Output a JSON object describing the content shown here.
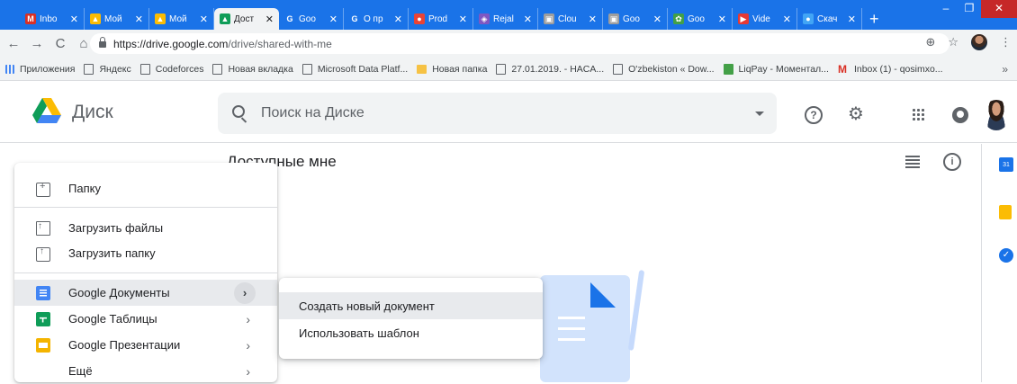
{
  "browser": {
    "tabs": [
      {
        "label": "Inbo",
        "color": "#d93025",
        "glyph": "M"
      },
      {
        "label": "Мой",
        "color": "#fbbc04",
        "glyph": "▲"
      },
      {
        "label": "Мой",
        "color": "#fbbc04",
        "glyph": "▲"
      },
      {
        "label": "Дост",
        "color": "#0f9d58",
        "glyph": "▲",
        "active": true
      },
      {
        "label": "Goo",
        "color": "#1a73e8",
        "glyph": "G"
      },
      {
        "label": "О пр",
        "color": "#1a73e8",
        "glyph": "G"
      },
      {
        "label": "Prod",
        "color": "#ea4335",
        "glyph": "●"
      },
      {
        "label": "Rejal",
        "color": "#7e57c2",
        "glyph": "◈"
      },
      {
        "label": "Clou",
        "color": "#9e9e9e",
        "glyph": "▣"
      },
      {
        "label": "Goo",
        "color": "#9e9e9e",
        "glyph": "▣"
      },
      {
        "label": "Goo",
        "color": "#43a047",
        "glyph": "✿"
      },
      {
        "label": "Vide",
        "color": "#e53935",
        "glyph": "▶"
      },
      {
        "label": "Скач",
        "color": "#42a5f5",
        "glyph": "●"
      }
    ],
    "new_tab": "+",
    "url_host": "https://drive.google.com",
    "url_path": "/drive/shared-with-me",
    "bookmarks": [
      {
        "label": "Приложения",
        "icon": "apps-icon"
      },
      {
        "label": "Яндекс",
        "icon": "page-icon"
      },
      {
        "label": "Codeforces",
        "icon": "page-icon"
      },
      {
        "label": "Новая вкладка",
        "icon": "page-icon"
      },
      {
        "label": "Microsoft Data Platf...",
        "icon": "page-icon"
      },
      {
        "label": "Новая папка",
        "icon": "folder-icon"
      },
      {
        "label": "27.01.2019. - HACA...",
        "icon": "nasa-icon"
      },
      {
        "label": "O'zbekiston « Dow...",
        "icon": "page-icon"
      },
      {
        "label": "LiqPay - Моментал...",
        "icon": "liqpay-icon"
      },
      {
        "label": "Inbox (1) - qosimxo...",
        "icon": "gmail-icon"
      }
    ],
    "bookmarks_more": "»"
  },
  "drive": {
    "title": "Диск",
    "search_placeholder": "Поиск на Диске",
    "page_title": "Доступные мне",
    "help_glyph": "?",
    "info_glyph": "i",
    "gear_glyph": "⚙",
    "calendar_glyph": "31",
    "tasks_glyph": "✓"
  },
  "new_menu": {
    "items": [
      {
        "label": "Папку"
      },
      {
        "label": "Загрузить файлы"
      },
      {
        "label": "Загрузить папку"
      },
      {
        "label": "Google Документы"
      },
      {
        "label": "Google Таблицы"
      },
      {
        "label": "Google Презентации"
      },
      {
        "label": "Ещё"
      }
    ],
    "chevron": "›"
  },
  "sub_menu": {
    "items": [
      {
        "label": "Создать новый документ"
      },
      {
        "label": "Использовать шаблон"
      }
    ]
  }
}
